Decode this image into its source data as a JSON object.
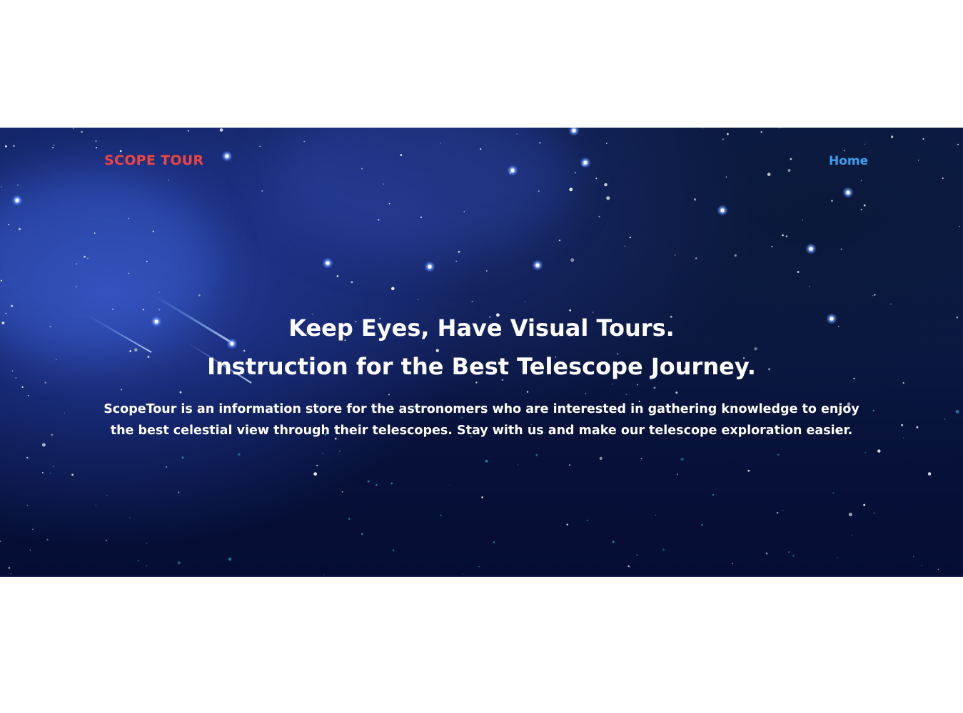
{
  "header": {
    "logo_text": "SCOPE TOUR",
    "nav": [
      {
        "label": "Home"
      }
    ]
  },
  "hero": {
    "headline_line1": "Keep Eyes, Have Visual Tours.",
    "headline_line2": "Instruction for the Best Telescope Journey.",
    "description_line1": "ScopeTour is an information store for the astronomers who are interested in gathering knowledge to enjoy",
    "description_line2": "the best celestial view through their telescopes. Stay with us and make our telescope exploration easier."
  },
  "colors": {
    "logo": "#ef4444",
    "nav_link": "#3b9ef0",
    "hero_text": "#ffffff",
    "hero_bg_dark": "#050d33",
    "hero_bg_blue": "#2a45b0",
    "page_bg": "#ffffff"
  }
}
